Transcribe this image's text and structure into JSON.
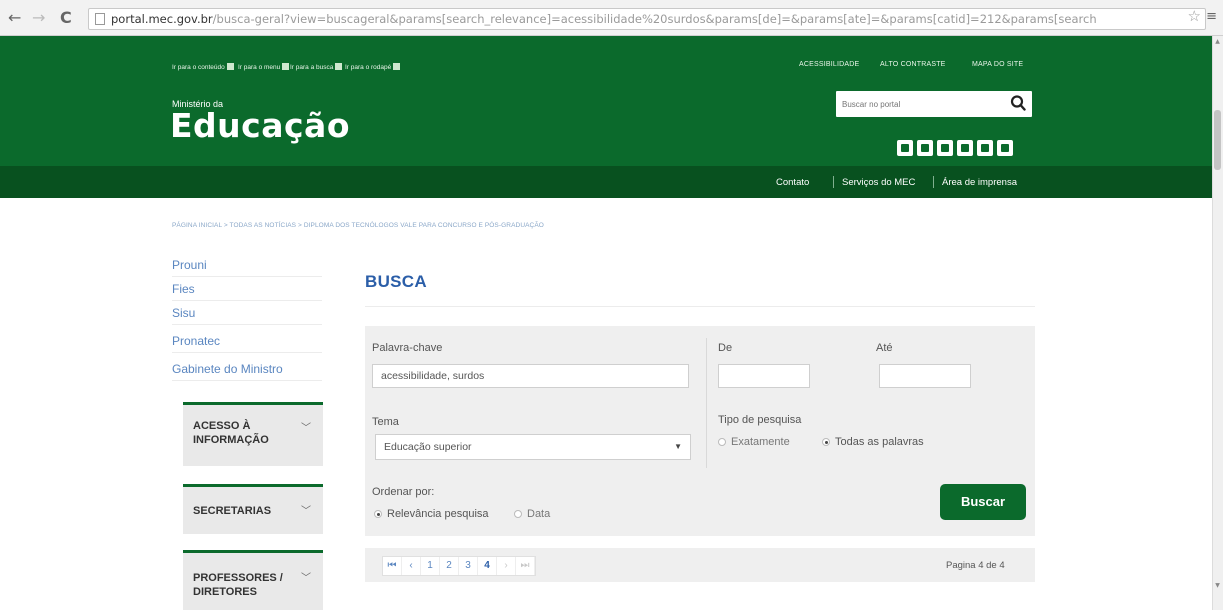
{
  "browser": {
    "url_host": "portal.mec.gov.br",
    "url_path": "/busca-geral?view=buscageral&params[search_relevance]=acessibilidade%20surdos&params[de]=&params[ate]=&params[catid]=212&params[search"
  },
  "header": {
    "skip_links": [
      "Ir para o conteúdo",
      "Ir para o menu",
      "Ir para a busca",
      "Ir para o rodapé"
    ],
    "top_links": [
      "ACESSIBILIDADE",
      "ALTO CONTRASTE",
      "MAPA DO SITE"
    ],
    "ministry_small": "Ministério da",
    "ministry_big": "Educação",
    "search_placeholder": "Buscar no portal",
    "social_icons": [
      "twitter-icon",
      "youtube-icon",
      "facebook-icon",
      "instagram-icon",
      "flickr-icon",
      "cloud-icon"
    ],
    "subnav": [
      "Contato",
      "Serviços do MEC",
      "Área de imprensa"
    ],
    "colors": {
      "green": "#0b6a2c",
      "dark_green": "#08511f"
    }
  },
  "breadcrumb": "PÁGINA INICIAL > TODAS AS NOTÍCIAS > DIPLOMA DOS TECNÓLOGOS VALE PARA CONCURSO E PÓS-GRADUAÇÃO",
  "sidebar": {
    "links": [
      "Prouni",
      "Fies",
      "Sisu",
      "Pronatec",
      "Gabinete do Ministro"
    ],
    "panels": [
      {
        "line1": "ACESSO À",
        "line2": "INFORMAÇÃO"
      },
      {
        "line1": "SECRETARIAS",
        "line2": ""
      },
      {
        "line1": "PROFESSORES /",
        "line2": "DIRETORES"
      }
    ]
  },
  "main": {
    "title": "BUSCA",
    "keyword_label": "Palavra-chave",
    "keyword_value": "acessibilidade, surdos",
    "de_label": "De",
    "ate_label": "Até",
    "tema_label": "Tema",
    "tema_value": "Educação superior",
    "tipo_label": "Tipo de pesquisa",
    "tipo_options": [
      "Exatamente",
      "Todas as palavras"
    ],
    "tipo_selected": "Todas as palavras",
    "ordenar_label": "Ordenar por:",
    "ordenar_options": [
      "Relevância pesquisa",
      "Data"
    ],
    "ordenar_selected": "Relevância pesquisa",
    "buscar_label": "Buscar"
  },
  "pagination": {
    "pages": [
      "1",
      "2",
      "3",
      "4"
    ],
    "current": "4",
    "info": "Pagina 4 de 4"
  }
}
